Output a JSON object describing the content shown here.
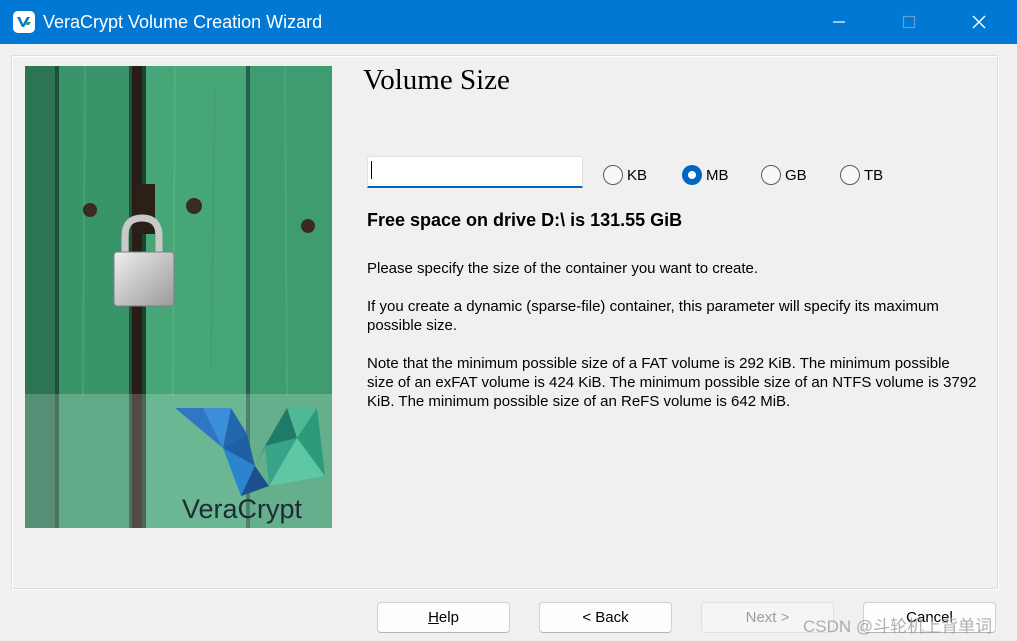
{
  "window": {
    "title": "VeraCrypt Volume Creation Wizard",
    "icons": {
      "app": "veracrypt-logo-icon",
      "minimize": "minimize-icon",
      "maximize": "maximize-icon",
      "close": "close-icon"
    },
    "titlebar_color": "#0078d4"
  },
  "side_image": {
    "description_icon": "padlock-door-image",
    "logo_text": "VeraCrypt"
  },
  "page": {
    "title": "Volume Size",
    "size_input": {
      "value": "",
      "placeholder": ""
    },
    "units": [
      {
        "label": "KB",
        "selected": false
      },
      {
        "label": "MB",
        "selected": true
      },
      {
        "label": "GB",
        "selected": false
      },
      {
        "label": "TB",
        "selected": false
      }
    ],
    "free_space": "Free space on drive D:\\ is 131.55 GiB",
    "info": [
      "Please specify the size of the container you want to create.",
      "If you create a dynamic (sparse-file) container, this parameter will specify its maximum possible size.",
      "Note that the minimum possible size of a FAT volume is 292 KiB. The minimum possible size of an exFAT volume is 424 KiB. The minimum possible size of an NTFS volume is 3792 KiB. The minimum possible size of an ReFS volume is 642 MiB."
    ]
  },
  "buttons": {
    "help": {
      "mnemonic": "H",
      "rest": "elp"
    },
    "back": "< Back",
    "next": "Next >",
    "cancel": "Cancel"
  },
  "watermark": "CSDN @斗轮机上背单词",
  "colors": {
    "accent": "#0067c0",
    "disabled_text": "#9d9d9d"
  }
}
